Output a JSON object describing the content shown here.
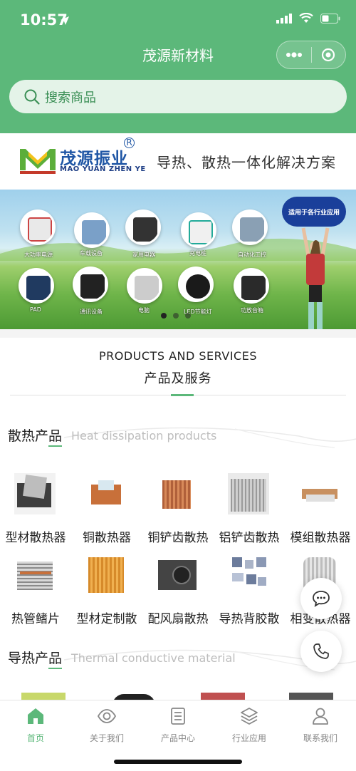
{
  "status_bar": {
    "time": "10:57"
  },
  "nav": {
    "title": "茂源新材料",
    "more_icon": "more-dots-icon",
    "close_icon": "target-circle-icon"
  },
  "search": {
    "placeholder": "搜索商品"
  },
  "brand": {
    "name_cn": "茂源振业",
    "name_en": "MAO YUAN ZHEN YE",
    "registered": "R",
    "slogan": "导热、散热一体化解决方案"
  },
  "banner": {
    "cloud_text": "适用于各行业应用",
    "captions": [
      "大功率电源",
      "车载设备",
      "家用电器",
      "充电桩",
      "自动化工控",
      "PAD",
      "通讯设备",
      "电脑",
      "LED节能灯",
      "功放音箱"
    ],
    "slides_total": 3,
    "active_slide": 1
  },
  "products_services": {
    "title_en": "PRODUCTS AND SERVICES",
    "title_cn": "产品及服务"
  },
  "sections": [
    {
      "title": "散热产品",
      "subtitle": "Heat dissipation products",
      "items": [
        {
          "label": "型材散热器",
          "color": "#555555"
        },
        {
          "label": "铜散热器",
          "color": "#c8703a"
        },
        {
          "label": "铜铲齿散热",
          "color": "#b0603a"
        },
        {
          "label": "铝铲齿散热",
          "color": "#9a9a9a"
        },
        {
          "label": "模组散热器",
          "color": "#c89060"
        },
        {
          "label": "热管鳍片",
          "color": "#8a8a8a"
        },
        {
          "label": "型材定制散",
          "color": "#d68a2a"
        },
        {
          "label": "配风扇散热",
          "color": "#444444"
        },
        {
          "label": "导热背胶散",
          "color": "#6c7c9c"
        },
        {
          "label": "相变散热器",
          "color": "#bdbdbd"
        }
      ]
    },
    {
      "title": "导热产品",
      "subtitle": "Thermal conductive  material",
      "items": [
        {
          "color": "#c8d86a"
        },
        {
          "color": "#222222"
        },
        {
          "color": "#c05050"
        },
        {
          "color": "#555555"
        }
      ]
    }
  ],
  "fabs": {
    "chat_icon": "chat-bubble-icon",
    "phone_icon": "phone-icon"
  },
  "tabbar": {
    "accent": "#5cb87a",
    "tabs": [
      {
        "label": "首页",
        "icon": "home-icon",
        "active": true
      },
      {
        "label": "关于我们",
        "icon": "eye-icon",
        "active": false
      },
      {
        "label": "产品中心",
        "icon": "list-icon",
        "active": false
      },
      {
        "label": "行业应用",
        "icon": "layers-icon",
        "active": false
      },
      {
        "label": "联系我们",
        "icon": "user-icon",
        "active": false
      }
    ]
  }
}
